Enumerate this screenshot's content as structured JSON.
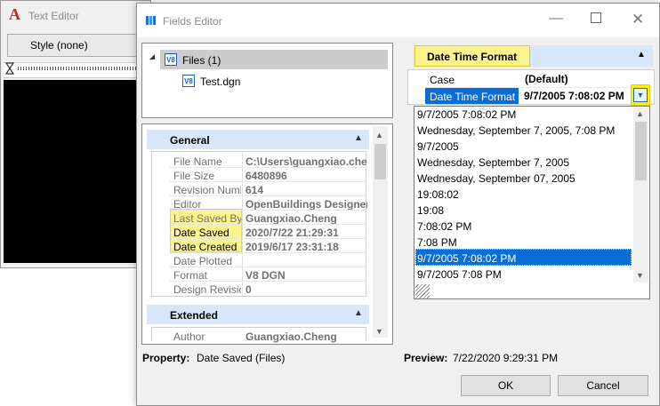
{
  "text_editor": {
    "logo": "A",
    "title": "Text Editor",
    "style_label": "Style (none)"
  },
  "fields_editor": {
    "title": "Fields Editor",
    "window_controls": {
      "minimize": "—",
      "close": "✕"
    },
    "tree": {
      "root_label": "Files (1)",
      "child_label": "Test.dgn",
      "icon_text": "V8"
    },
    "general": {
      "header": "General",
      "rows": [
        {
          "name": "File Name",
          "value": "C:\\Users\\guangxiao.che"
        },
        {
          "name": "File Size",
          "value": "6480896"
        },
        {
          "name": "Revision Numb",
          "value": "614"
        },
        {
          "name": "Editor",
          "value": "OpenBuildings Designer"
        },
        {
          "name": "Last Saved By",
          "value": "Guangxiao.Cheng"
        },
        {
          "name": "Date Saved",
          "value": "2020/7/22 21:29:31"
        },
        {
          "name": "Date Created",
          "value": "2019/6/17 23:31:18"
        },
        {
          "name": "Date Plotted",
          "value": ""
        },
        {
          "name": "Format",
          "value": "V8 DGN"
        },
        {
          "name": "Design Revisio",
          "value": "0"
        }
      ]
    },
    "extended": {
      "header": "Extended",
      "rows": [
        {
          "name": "Author",
          "value": "Guangxiao.Cheng"
        }
      ]
    },
    "format_panel": {
      "header": "Date Time Format",
      "case_name": "Case",
      "case_value": "(Default)",
      "format_name": "Date Time Format",
      "format_value": "9/7/2005 7:08:02 PM",
      "options": [
        "9/7/2005 7:08:02 PM",
        "Wednesday, September 7, 2005, 7:08 PM",
        "9/7/2005",
        "Wednesday, September 7, 2005",
        "Wednesday, September 07, 2005",
        "19:08:02",
        "19:08",
        "7:08:02 PM",
        "7:08 PM",
        "9/7/2005 7:08:02 PM",
        "9/7/2005 7:08 PM"
      ],
      "selected_index": 9
    },
    "property_label": "Property:",
    "property_value": "Date Saved (Files)",
    "preview_label": "Preview:",
    "preview_value": "7/22/2020 9:29:31 PM",
    "ok_label": "OK",
    "cancel_label": "Cancel"
  },
  "colors": {
    "selection_blue": "#0a6dd6",
    "group_header": "#d7e6f8",
    "highlight_yellow": "#fff200"
  }
}
